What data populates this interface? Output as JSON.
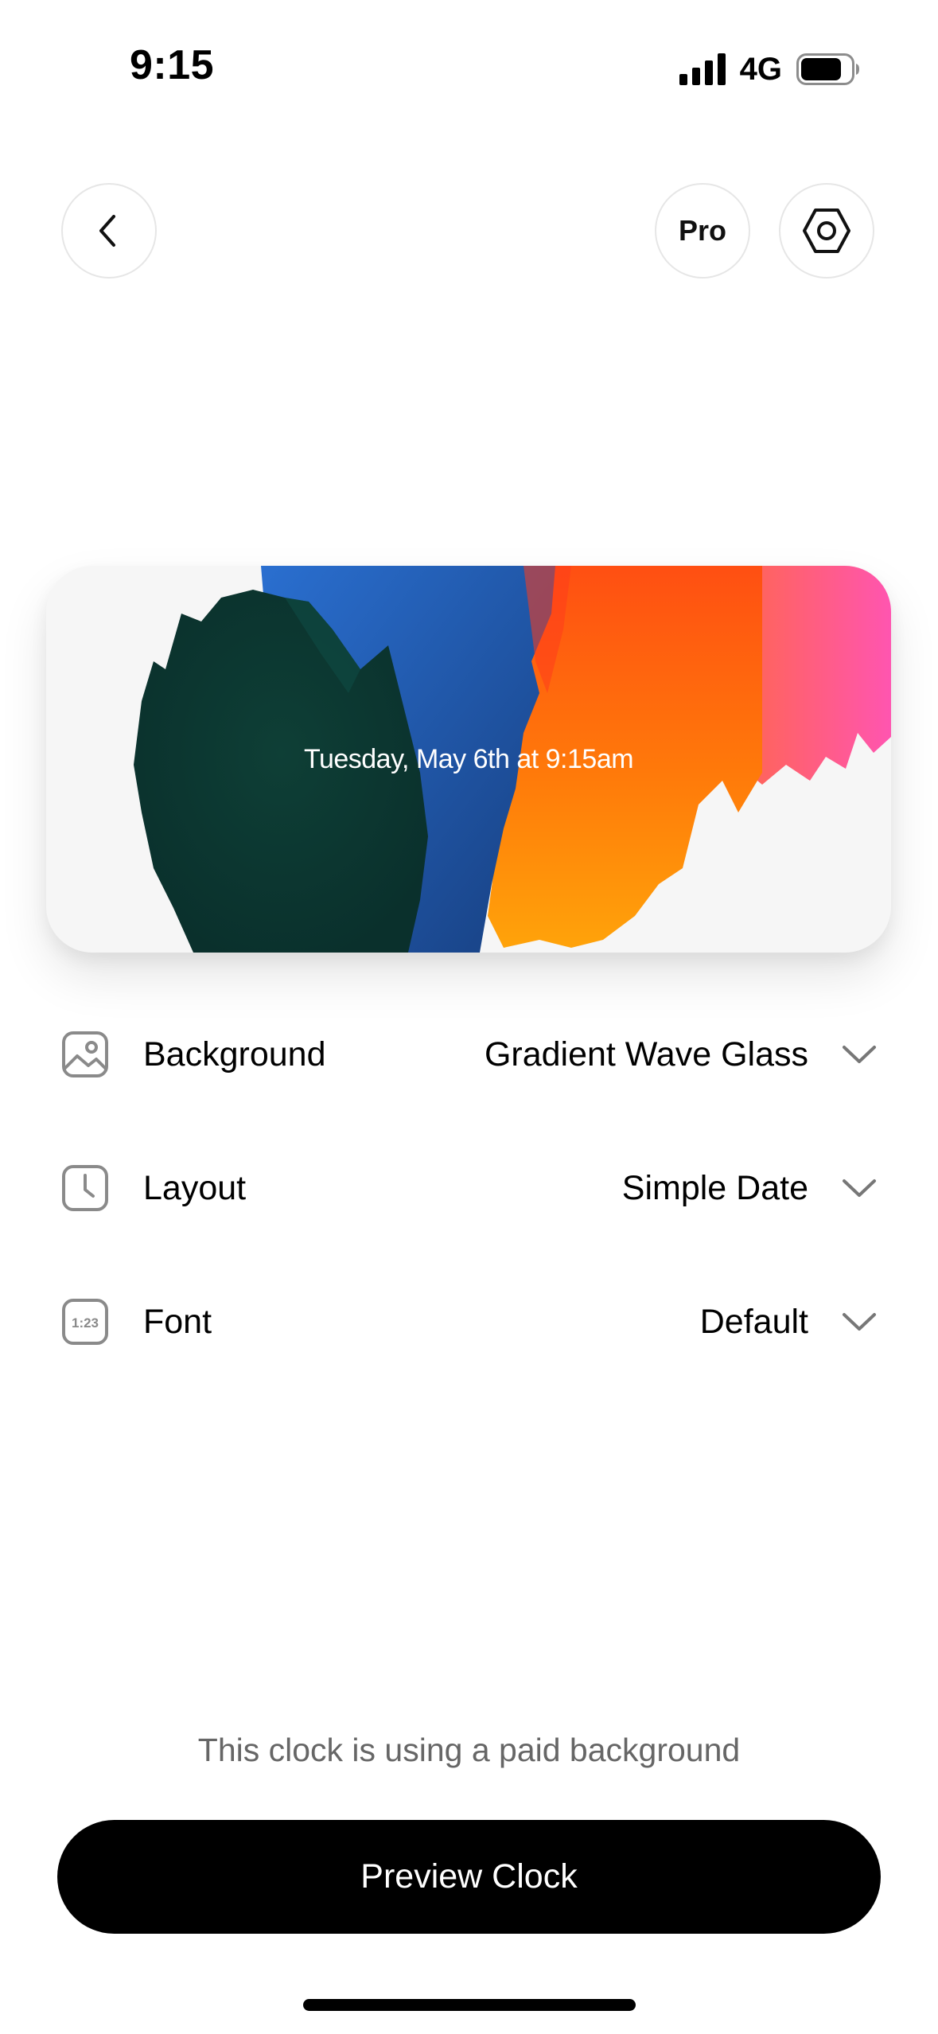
{
  "status_bar": {
    "time": "9:15",
    "network": "4G",
    "signal_icon": "signal-bars-icon",
    "battery_icon": "battery-icon"
  },
  "header": {
    "back_icon": "chevron-left-icon",
    "pro_label": "Pro",
    "settings_icon": "hexagon-settings-icon"
  },
  "preview": {
    "date_text": "Tuesday, May 6th at 9:15am",
    "colors": {
      "dark_green": "#0d3b34",
      "blue": "#1f5fb0",
      "orange": "#ff6a12",
      "amber": "#ff9f0a",
      "pink": "#ff5aa8"
    }
  },
  "options": {
    "background": {
      "label": "Background",
      "value": "Gradient Wave Glass",
      "icon": "image-icon"
    },
    "layout": {
      "label": "Layout",
      "value": "Simple Date",
      "icon": "clock-icon"
    },
    "font": {
      "label": "Font",
      "value": "Default",
      "icon": "font-123-icon",
      "icon_text": "1:23"
    }
  },
  "footer": {
    "note": "This clock is using a paid background",
    "button_label": "Preview Clock"
  }
}
